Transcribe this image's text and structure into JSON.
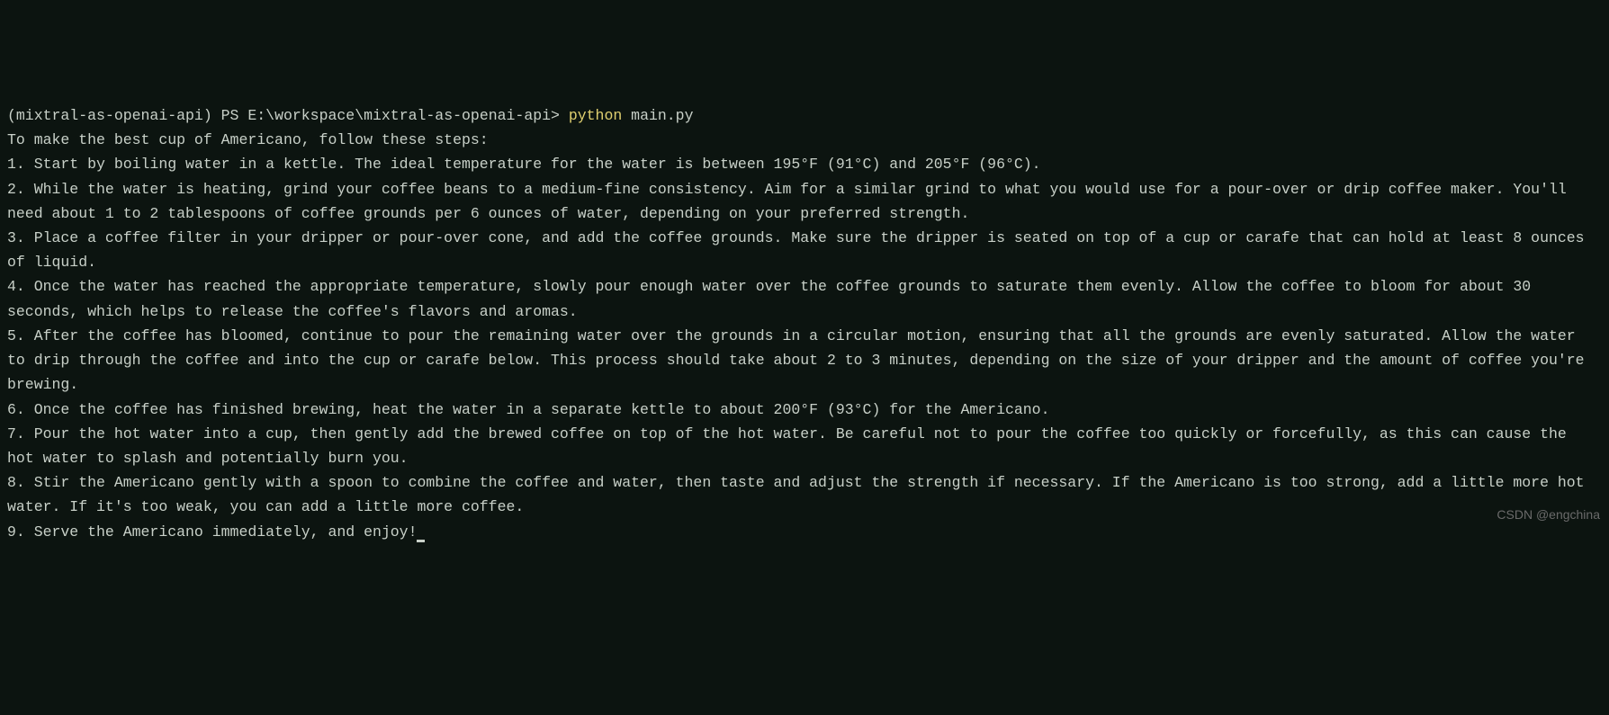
{
  "prompt": {
    "env": "(mixtral-as-openai-api)",
    "shell": "PS",
    "path": "E:\\workspace\\mixtral-as-openai-api>",
    "command_keyword": "python",
    "command_arg": "main.py"
  },
  "output": {
    "intro": "To make the best cup of Americano, follow these steps:",
    "blank": "",
    "steps": [
      "1. Start by boiling water in a kettle. The ideal temperature for the water is between 195°F (91°C) and 205°F (96°C).",
      "2. While the water is heating, grind your coffee beans to a medium-fine consistency. Aim for a similar grind to what you would use for a pour-over or drip coffee maker. You'll need about 1 to 2 tablespoons of coffee grounds per 6 ounces of water, depending on your preferred strength.",
      "3. Place a coffee filter in your dripper or pour-over cone, and add the coffee grounds. Make sure the dripper is seated on top of a cup or carafe that can hold at least 8 ounces of liquid.",
      "4. Once the water has reached the appropriate temperature, slowly pour enough water over the coffee grounds to saturate them evenly. Allow the coffee to bloom for about 30 seconds, which helps to release the coffee's flavors and aromas.",
      "5. After the coffee has bloomed, continue to pour the remaining water over the grounds in a circular motion, ensuring that all the grounds are evenly saturated. Allow the water to drip through the coffee and into the cup or carafe below. This process should take about 2 to 3 minutes, depending on the size of your dripper and the amount of coffee you're brewing.",
      "6. Once the coffee has finished brewing, heat the water in a separate kettle to about 200°F (93°C) for the Americano.",
      "7. Pour the hot water into a cup, then gently add the brewed coffee on top of the hot water. Be careful not to pour the coffee too quickly or forcefully, as this can cause the hot water to splash and potentially burn you.",
      "8. Stir the Americano gently with a spoon to combine the coffee and water, then taste and adjust the strength if necessary. If the Americano is too strong, add a little more hot water. If it's too weak, you can add a little more coffee.",
      "9. Serve the Americano immediately, and enjoy!"
    ]
  },
  "watermark": "CSDN @engchina"
}
